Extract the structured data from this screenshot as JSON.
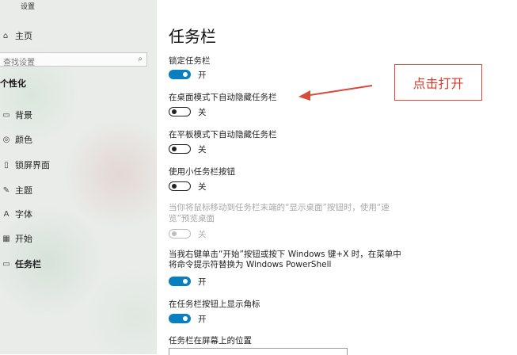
{
  "sidebar": {
    "window_title": "设置",
    "home": "主页",
    "search_placeholder": "查找设置",
    "section": "个性化",
    "items": [
      {
        "label": "背景"
      },
      {
        "label": "颜色"
      },
      {
        "label": "锁屏界面"
      },
      {
        "label": "主题"
      },
      {
        "label": "字体"
      },
      {
        "label": "开始"
      },
      {
        "label": "任务栏"
      }
    ]
  },
  "main": {
    "title": "任务栏",
    "settings": [
      {
        "label": "锁定任务栏",
        "state": "开",
        "on": true
      },
      {
        "label": "在桌面模式下自动隐藏任务栏",
        "state": "关",
        "on": false
      },
      {
        "label": "在平板模式下自动隐藏任务栏",
        "state": "关",
        "on": false
      },
      {
        "label": "使用小任务栏按钮",
        "state": "关",
        "on": false
      },
      {
        "label": "当你将鼠标移动到任务栏末端的“显示桌面”按钮时，使用“速览”预览桌面",
        "state": "关",
        "on": false,
        "disabled": true
      },
      {
        "label": "当我右键单击“开始”按钮或按下 Windows 键+X 时，在菜单中将命令提示符替换为 Windows PowerShell",
        "state": "开",
        "on": true
      },
      {
        "label": "在任务栏按钮上显示角标",
        "state": "开",
        "on": true
      }
    ],
    "position_label": "任务栏在屏幕上的位置"
  },
  "annotation": {
    "text": "点击打开",
    "color": "#d43b2d"
  },
  "colors": {
    "accent": "#0a7fbf"
  }
}
